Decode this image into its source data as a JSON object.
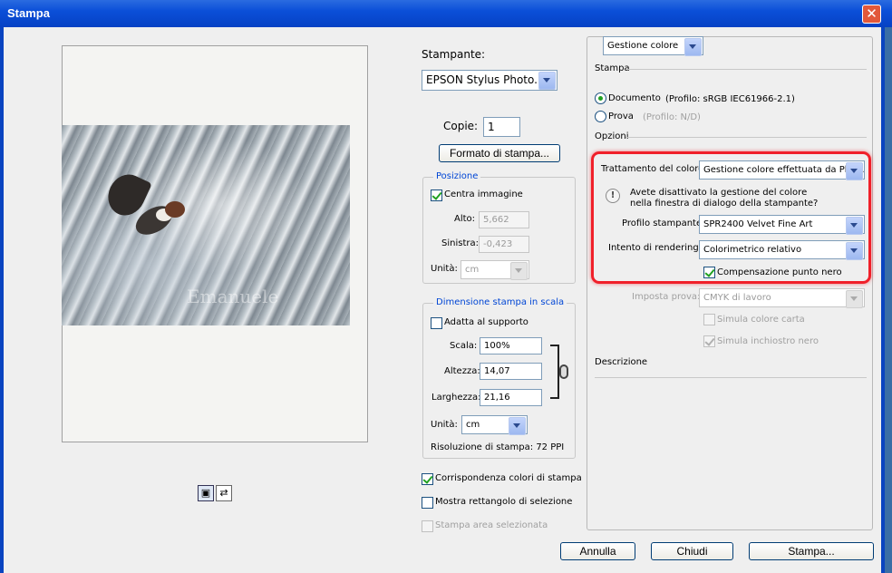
{
  "window": {
    "title": "Stampa",
    "close_symbol": "✕"
  },
  "preview": {
    "watermark": "Emanuele",
    "icons": [
      "page-portrait-icon",
      "page-landscape-icon"
    ]
  },
  "printer": {
    "label": "Stampante:",
    "value": "EPSON Stylus Photo..."
  },
  "copies": {
    "label": "Copie:",
    "value": "1"
  },
  "page_setup_button": "Formato di stampa...",
  "position": {
    "title": "Posizione",
    "center_label": "Centra immagine",
    "top_label": "Alto:",
    "top_value": "5,662",
    "left_label": "Sinistra:",
    "left_value": "-0,423",
    "units_label": "Unità:",
    "units_value": "cm"
  },
  "scaled_size": {
    "title": "Dimensione stampa in scala",
    "fit_label": "Adatta al supporto",
    "scale_label": "Scala:",
    "scale_value": "100%",
    "height_label": "Altezza:",
    "height_value": "14,07",
    "width_label": "Larghezza:",
    "width_value": "21,16",
    "units_label": "Unità:",
    "units_value": "cm",
    "resolution": "Risoluzione di stampa: 72 PPI"
  },
  "bottom_checks": {
    "match_colors": "Corrispondenza colori di stampa",
    "selection_rect": "Mostra rettangolo di selezione",
    "print_selection": "Stampa area selezionata"
  },
  "right": {
    "mode": "Gestione colore",
    "stampa_label": "Stampa",
    "document_label": "Documento",
    "document_profile": "(Profilo: sRGB IEC61966-2.1)",
    "proof_label": "Prova",
    "proof_profile": "(Profilo: N/D)",
    "options_label": "Opzioni",
    "color_handling_label": "Trattamento del colore:",
    "color_handling_value": "Gestione colore effettuata da Pho...",
    "warning_line1": "Avete disattivato la gestione del colore",
    "warning_line2": "nella finestra di dialogo della stampante?",
    "printer_profile_label": "Profilo stampante:",
    "printer_profile_value": "SPR2400 Velvet Fine Art",
    "rendering_label": "Intento di rendering:",
    "rendering_value": "Colorimetrico relativo",
    "bpc_label": "Compensazione punto nero",
    "proof_setup_label": "Imposta prova:",
    "proof_setup_value": "CMYK di lavoro",
    "sim_paper": "Simula colore carta",
    "sim_black": "Simula inchiostro nero",
    "description_label": "Descrizione"
  },
  "buttons": {
    "cancel": "Annulla",
    "close": "Chiudi",
    "print": "Stampa..."
  },
  "colors": {
    "titlebar": "#0b4fd8",
    "highlight": "#f0202a",
    "group_title": "#0046d5"
  }
}
